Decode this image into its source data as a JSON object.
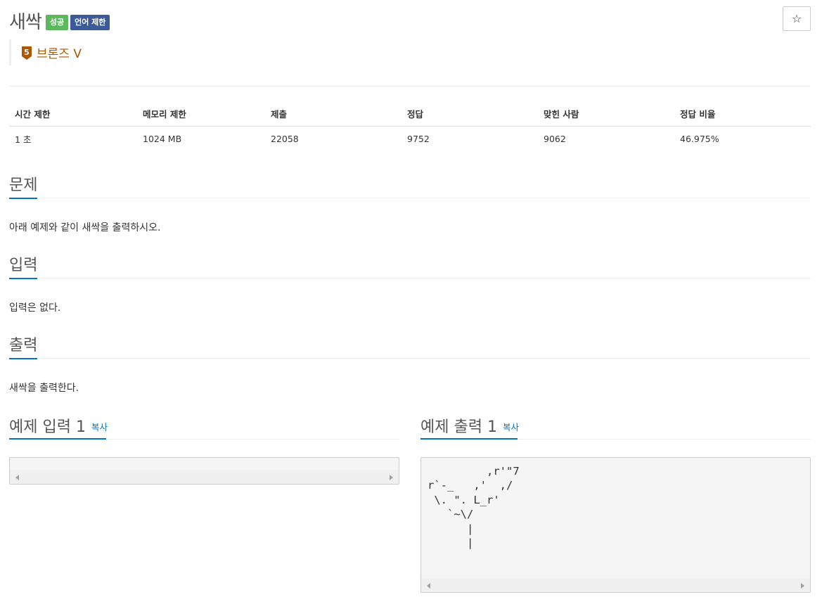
{
  "problem": {
    "title": "새싹",
    "badges": {
      "success": "성공",
      "language": "언어 제한"
    },
    "tier": {
      "number": "5",
      "label": "브론즈 V",
      "color": "#ad5600"
    },
    "star_icon": "☆"
  },
  "info_table": {
    "headers": [
      "시간 제한",
      "메모리 제한",
      "제출",
      "정답",
      "맞힌 사람",
      "정답 비율"
    ],
    "values": [
      "1 초",
      "1024 MB",
      "22058",
      "9752",
      "9062",
      "46.975%"
    ]
  },
  "sections": {
    "problem": {
      "heading": "문제",
      "text": "아래 예제와 같이 새싹을 출력하시오."
    },
    "input": {
      "heading": "입력",
      "text": "입력은 없다."
    },
    "output": {
      "heading": "출력",
      "text": "새싹을 출력한다."
    }
  },
  "examples": {
    "input": {
      "heading": "예제 입력 1",
      "copy_label": "복사",
      "content": ""
    },
    "output": {
      "heading": "예제 출력 1",
      "copy_label": "복사",
      "content": "         ,r'\"7\nr`-_   ,'  ,/\n \\. \". L_r'\n   `~\\/\n      |\n      |"
    }
  },
  "colors": {
    "accent": "#0076c0",
    "success": "#5cb85c",
    "language_badge": "#3d5a98",
    "bronze": "#ad5600"
  }
}
